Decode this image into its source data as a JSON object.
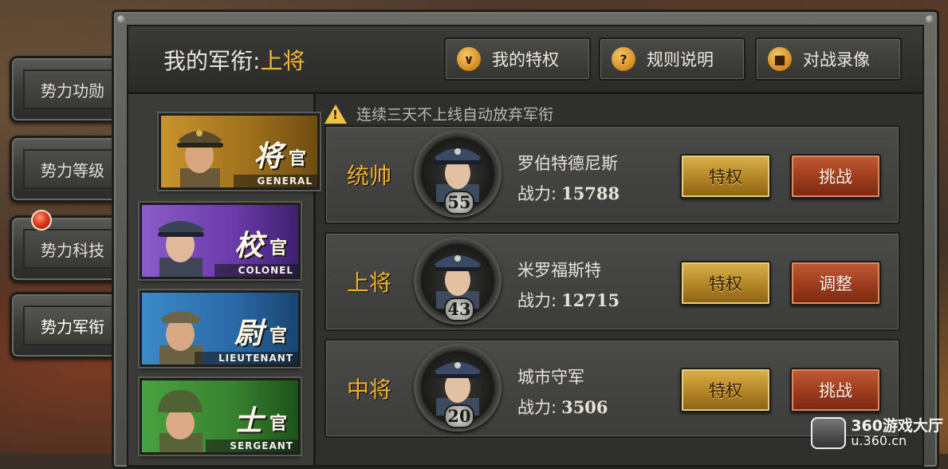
{
  "header": {
    "rank_label": "我的军衔:",
    "rank_value": "上将",
    "buttons": [
      {
        "label": "我的特权",
        "icon": "chevron-down-icon"
      },
      {
        "label": "规则说明",
        "icon": "question-icon"
      },
      {
        "label": "对战录像",
        "icon": "video-camera-icon"
      }
    ]
  },
  "sidebar": {
    "items": [
      {
        "label": "势力功勋"
      },
      {
        "label": "势力等级"
      },
      {
        "label": "势力科技"
      },
      {
        "label": "势力军衔"
      }
    ]
  },
  "rank_cards": [
    {
      "rank": "将",
      "suffix": "官",
      "english": "GENERAL"
    },
    {
      "rank": "校",
      "suffix": "官",
      "english": "COLONEL"
    },
    {
      "rank": "尉",
      "suffix": "官",
      "english": "LIEUTENANT"
    },
    {
      "rank": "士",
      "suffix": "官",
      "english": "SERGEANT"
    }
  ],
  "notice": "连续三天不上线自动放弃军衔",
  "rows": [
    {
      "rank": "统帅",
      "level": "55",
      "name": "罗伯特德尼斯",
      "power_label": "战力:",
      "power": "15788",
      "btn1": "特权",
      "btn2": "挑战"
    },
    {
      "rank": "上将",
      "level": "43",
      "name": "米罗福斯特",
      "power_label": "战力:",
      "power": "12715",
      "btn1": "特权",
      "btn2": "调整"
    },
    {
      "rank": "中将",
      "level": "20",
      "name": "城市守军",
      "power_label": "战力:",
      "power": "3506",
      "btn1": "特权",
      "btn2": "挑战"
    }
  ],
  "watermark": {
    "line1": "360游戏大厅",
    "line2": "u.360.cn"
  },
  "colors": {
    "accent_gold": "#f0b63a",
    "btn_gold": "#c89a38",
    "btn_red": "#a8462a"
  }
}
